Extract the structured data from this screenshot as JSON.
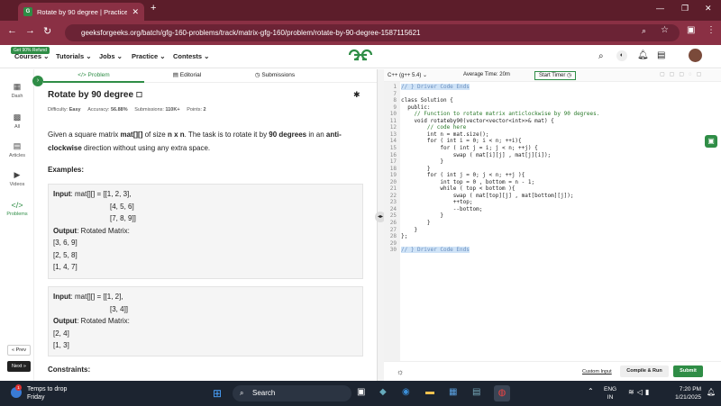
{
  "browser": {
    "tab_title": "Rotate by 90 degree | Practice |",
    "url": "geeksforgeeks.org/batch/gfg-160-problems/track/matrix-gfg-160/problem/rotate-by-90-degree-1587115621"
  },
  "header": {
    "promo": "Get 90% Refund",
    "menu": [
      "Courses",
      "Tutorials",
      "Jobs",
      "Practice",
      "Contests"
    ],
    "logo": "GfG"
  },
  "rail": {
    "items": [
      "Dash",
      "All",
      "Articles",
      "Videos",
      "Problems"
    ],
    "prev": "« Prev",
    "next": "Next »"
  },
  "tabs": [
    "Problem",
    "Editorial",
    "Submissions"
  ],
  "problem": {
    "title": "Rotate by 90 degree",
    "meta": {
      "difficulty_label": "Difficulty:",
      "difficulty": "Easy",
      "accuracy_label": "Accuracy:",
      "accuracy": "56.88%",
      "submissions_label": "Submissions:",
      "submissions": "110K+",
      "points_label": "Points:",
      "points": "2"
    },
    "desc_1": "Given a square matrix ",
    "desc_bold1": "mat[][]",
    "desc_2": " of size ",
    "desc_bold2": "n x n",
    "desc_3": ". The task is to rotate it by ",
    "desc_bold3": "90 degrees",
    "desc_4": " in an ",
    "desc_bold4": "anti-clockwise",
    "desc_5": " direction without using any extra space.",
    "examples_heading": "Examples:",
    "example1": {
      "input_label": "Input",
      "input_lines": [
        ":  mat[][] = [[1,  2,  3],",
        "[4,  5,  6]",
        "[7,  8,  9]]"
      ],
      "output_label": "Output",
      "output_text": ":  Rotated  Matrix:",
      "output_lines": [
        "[3,  6,  9]",
        "[2,  5,  8]",
        "[1,  4,  7]"
      ]
    },
    "example2": {
      "input_label": "Input",
      "input_lines": [
        ":  mat[][] = [[1,  2],",
        "[3,  4]]"
      ],
      "output_label": "Output",
      "output_text": ":  Rotated  Matrix:",
      "output_lines": [
        "[2,  4]",
        "[1,  3]"
      ]
    },
    "constraints_heading": "Constraints:"
  },
  "editor": {
    "language": "C++ (g++ 5.4)",
    "avg_time": "Average Time: 20m",
    "timer_btn": "Start Timer",
    "lines": [
      {
        "n": "1",
        "t": "// } Driver Code Ends"
      },
      {
        "n": "7",
        "t": ""
      },
      {
        "n": "8",
        "t": "class Solution {"
      },
      {
        "n": "9",
        "t": "  public:"
      },
      {
        "n": "10",
        "t": "    // Function to rotate matrix anticlockwise by 90 degrees."
      },
      {
        "n": "11",
        "t": "    void rotateby90(vector<vector<int>>& mat) {"
      },
      {
        "n": "12",
        "t": "        // code here"
      },
      {
        "n": "13",
        "t": "        int n = mat.size();"
      },
      {
        "n": "14",
        "t": "        for ( int i = 0; i < n; ++i){"
      },
      {
        "n": "15",
        "t": "            for ( int j = i; j < n; ++j) {"
      },
      {
        "n": "16",
        "t": "                swap ( mat[i][j] , mat[j][i]);"
      },
      {
        "n": "17",
        "t": "            }"
      },
      {
        "n": "18",
        "t": "        }"
      },
      {
        "n": "19",
        "t": "        for ( int j = 0; j < n; ++j ){"
      },
      {
        "n": "20",
        "t": "            int top = 0 , bottom = n - 1;"
      },
      {
        "n": "21",
        "t": "            while ( top < bottom ){"
      },
      {
        "n": "22",
        "t": "                swap ( mat[top][j] , mat[bottom][j]);"
      },
      {
        "n": "23",
        "t": "                ++top;"
      },
      {
        "n": "24",
        "t": "                --bottom;"
      },
      {
        "n": "25",
        "t": "            }"
      },
      {
        "n": "26",
        "t": "        }"
      },
      {
        "n": "27",
        "t": "    }"
      },
      {
        "n": "28",
        "t": "};"
      },
      {
        "n": "29",
        "t": ""
      },
      {
        "n": "30",
        "t": "// } Driver Code Ends"
      }
    ],
    "custom_input": "Custom Input",
    "compile_btn": "Compile & Run",
    "submit_btn": "Submit"
  },
  "taskbar": {
    "weather_title": "Temps to drop",
    "weather_sub": "Friday",
    "search": "Search",
    "lang1": "ENG",
    "lang2": "IN",
    "time": "7:20 PM",
    "date": "1/21/2025"
  },
  "colors": {
    "brand": "#2f8d46",
    "browser": "#8a3044",
    "taskbar": "#1c2430"
  }
}
